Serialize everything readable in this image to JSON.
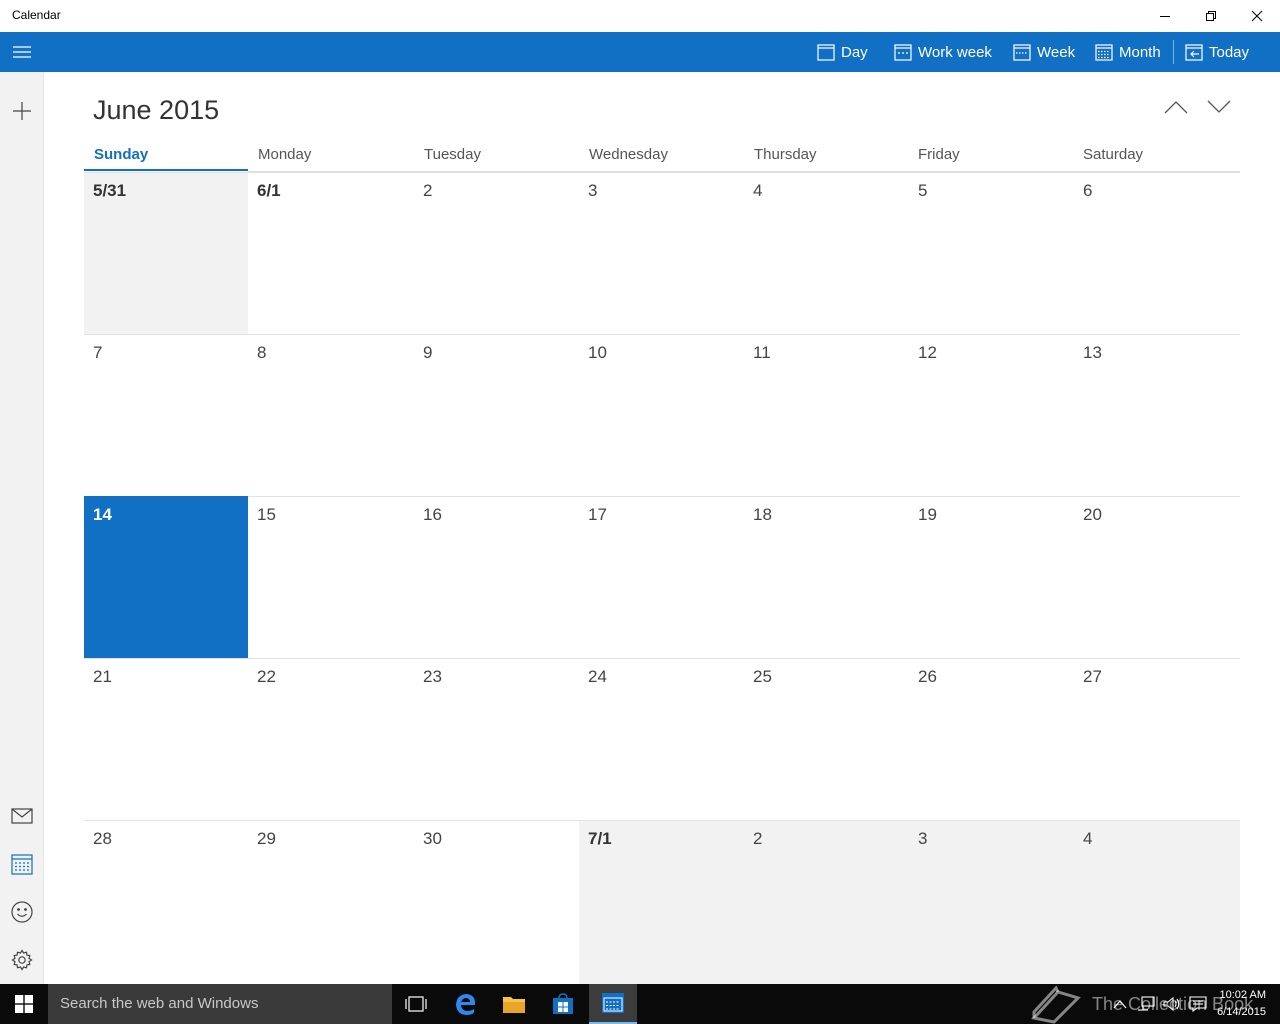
{
  "window": {
    "title": "Calendar"
  },
  "commandbar": {
    "views": [
      {
        "label": "Day",
        "icon": "day-view-icon"
      },
      {
        "label": "Work week",
        "icon": "work-week-view-icon"
      },
      {
        "label": "Week",
        "icon": "week-view-icon"
      },
      {
        "label": "Month",
        "icon": "month-view-icon"
      },
      {
        "label": "Today",
        "icon": "today-icon"
      }
    ]
  },
  "main": {
    "month_title": "June 2015",
    "weekdays": [
      "Sunday",
      "Monday",
      "Tuesday",
      "Wednesday",
      "Thursday",
      "Friday",
      "Saturday"
    ],
    "active_weekday": "Sunday",
    "weeks": [
      [
        "5/31",
        "6/1",
        "2",
        "3",
        "4",
        "5",
        "6"
      ],
      [
        "7",
        "8",
        "9",
        "10",
        "11",
        "12",
        "13"
      ],
      [
        "14",
        "15",
        "16",
        "17",
        "18",
        "19",
        "20"
      ],
      [
        "21",
        "22",
        "23",
        "24",
        "25",
        "26",
        "27"
      ],
      [
        "28",
        "29",
        "30",
        "7/1",
        "2",
        "3",
        "4"
      ]
    ],
    "today": "14"
  },
  "taskbar": {
    "search_placeholder": "Search the web and Windows",
    "watermark": "The Collection Book",
    "time": "10:02 AM",
    "date": "6/14/2015"
  },
  "colors": {
    "accent": "#1170c4",
    "other_month_bg": "#f2f2f2",
    "taskbar": "#0a0a0a"
  }
}
